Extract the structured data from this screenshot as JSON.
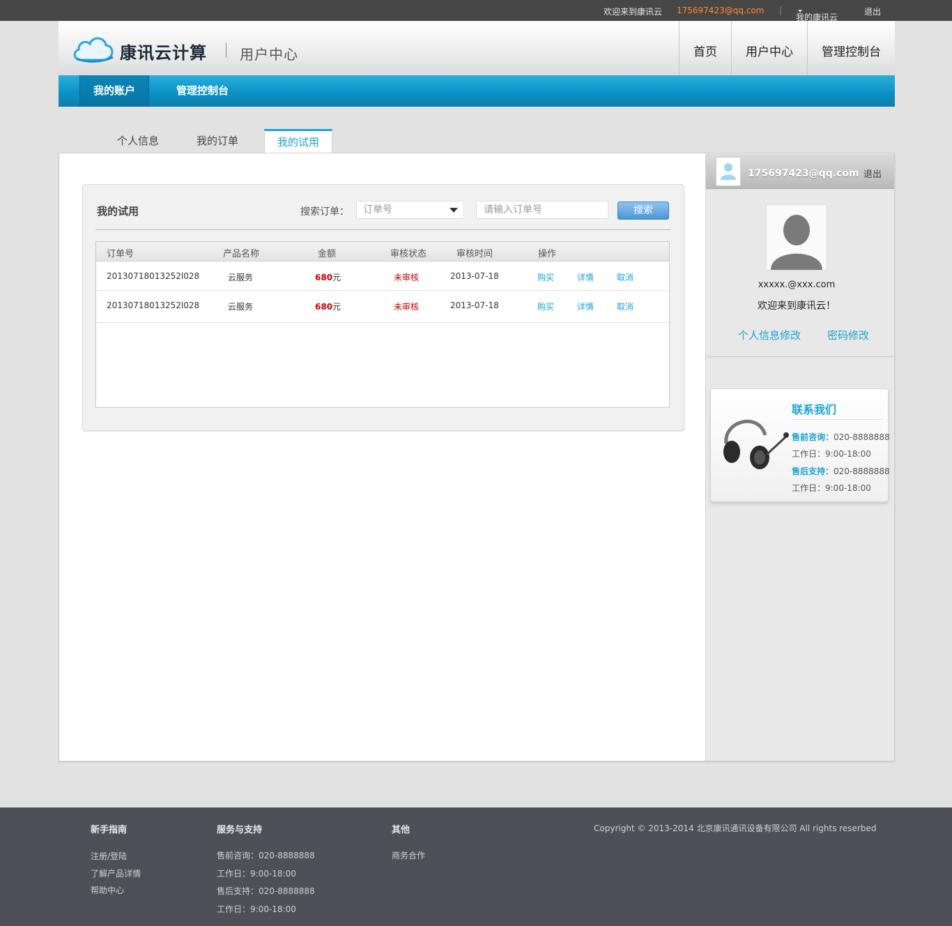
{
  "topbar": {
    "welcome": "欢迎来到康讯云",
    "email": "175697423@qq.com",
    "separator": "|",
    "my_cloud": "我的康讯云",
    "logout": "退出"
  },
  "header": {
    "brand": "康讯云计算",
    "subtitle": "用户中心",
    "nav": [
      "首页",
      "用户中心",
      "管理控制台"
    ]
  },
  "subnav": {
    "active": "我的账户",
    "console": "管理控制台"
  },
  "tabs": [
    "个人信息",
    "我的订单",
    "我的试用"
  ],
  "trial": {
    "title": "我的试用",
    "search_label": "搜索订单：",
    "select_value": "订单号",
    "input_placeholder": "请输入订单号",
    "search_button": "搜索",
    "columns": [
      "订单号",
      "产品名称",
      "金额",
      "审核状态",
      "审核时间",
      "操作"
    ],
    "rows": [
      {
        "order_no": "20130718013252l028",
        "product": "云服务",
        "amount": "680",
        "unit": "元",
        "status": "未审核",
        "time": "2013-07-18",
        "actions": [
          "购买",
          "详情",
          "取消"
        ]
      },
      {
        "order_no": "20130718013252l028",
        "product": "云服务",
        "amount": "680",
        "unit": "元",
        "status": "未审核",
        "time": "2013-07-18",
        "actions": [
          "购买",
          "详情",
          "取消"
        ]
      }
    ]
  },
  "sidebar": {
    "user_email": "175697423@qq.com",
    "logout": "退出",
    "profile_email": "xxxxx.@xxx.com",
    "welcome": "欢迎来到康讯云！",
    "link_profile": "个人信息修改",
    "link_password": "密码修改"
  },
  "contact": {
    "title": "联系我们",
    "presale_label": "售前咨询：",
    "presale_phone": "020-8888888",
    "workday1": "工作日：9:00-18:00",
    "aftersale_label": "售后支持：",
    "aftersale_phone": "020-8888888",
    "workday2": "工作日：9:00-18:00"
  },
  "footer": {
    "col1_title": "新手指南",
    "col1_links": [
      "注册/登陆",
      "了解产品详情",
      "帮助中心"
    ],
    "col2_title": "服务与支持",
    "col2_lines": [
      "售前咨询：020-8888888",
      "工作日：9:00-18:00",
      "售后支持：020-8888888",
      "工作日：9:00-18:00"
    ],
    "col3_title": "其他",
    "col3_links": [
      "商务合作"
    ],
    "copyright": "Copyright © 2013-2014  北京康讯通讯设备有限公司   All rights reserbed"
  },
  "colors": {
    "accent": "#1ba3d6",
    "topbar": "#474747",
    "email_orange": "#ff8a33",
    "danger": "#cc0000",
    "footer": "#4f5057"
  }
}
